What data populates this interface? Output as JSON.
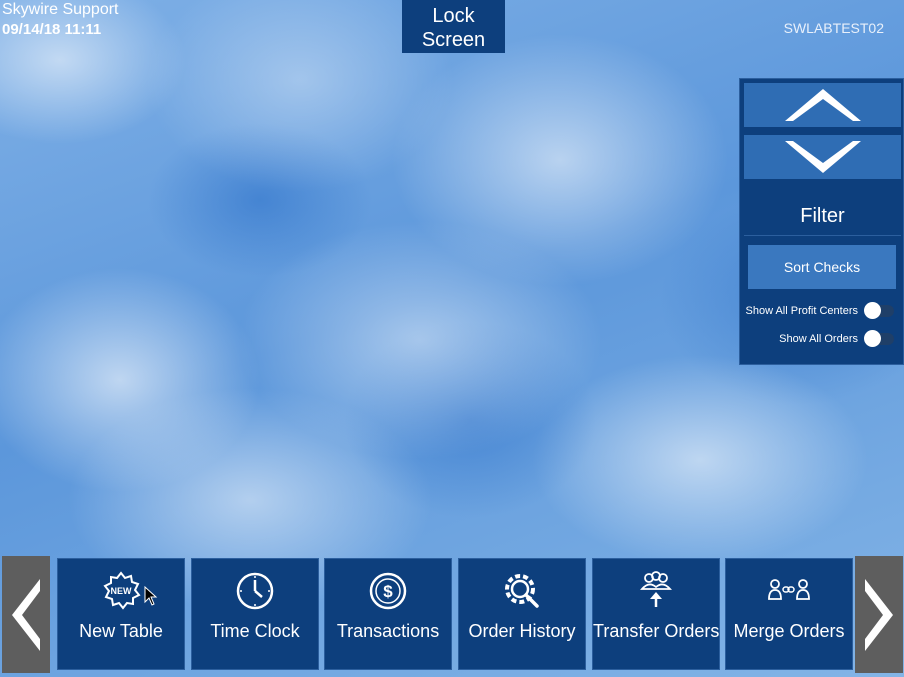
{
  "header": {
    "store_name": "Skywire Support",
    "datetime": "09/14/18 11:11",
    "lock_screen": "Lock Screen",
    "terminal_name": "SWLABTEST02"
  },
  "side_panel": {
    "filter_title": "Filter",
    "sort_label": "Sort Checks",
    "toggles": [
      {
        "label": "Show All Profit Centers",
        "on": false
      },
      {
        "label": "Show All Orders",
        "on": false
      }
    ]
  },
  "actions": [
    {
      "label": "New Table",
      "icon": "new-badge-icon"
    },
    {
      "label": "Time Clock",
      "icon": "clock-icon"
    },
    {
      "label": "Transactions",
      "icon": "dollar-icon"
    },
    {
      "label": "Order History",
      "icon": "gear-search-icon"
    },
    {
      "label": "Transfer Orders",
      "icon": "transfer-icon"
    },
    {
      "label": "Merge Orders",
      "icon": "merge-icon"
    }
  ],
  "colors": {
    "tile": "#0d3f7d",
    "accent": "#2f6db4",
    "nav_arrow": "#5e5e5e"
  }
}
